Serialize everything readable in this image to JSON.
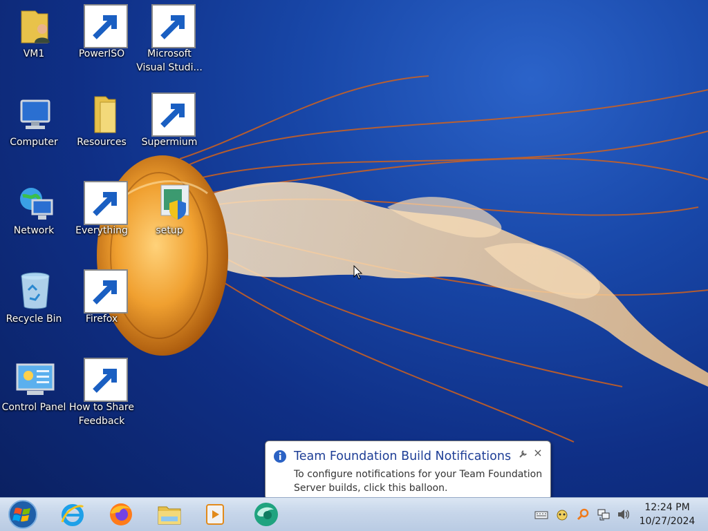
{
  "desktop": {
    "icons": [
      {
        "label": "VM1",
        "icon": "user-folder-icon"
      },
      {
        "label": "PowerISO",
        "icon": "poweriso-icon"
      },
      {
        "label": "Microsoft Visual Studi...",
        "icon": "visual-studio-icon"
      },
      {
        "label": "Computer",
        "icon": "computer-icon"
      },
      {
        "label": "Resources",
        "icon": "folder-icon"
      },
      {
        "label": "Supermium",
        "icon": "supermium-icon"
      },
      {
        "label": "Network",
        "icon": "network-icon"
      },
      {
        "label": "Everything",
        "icon": "everything-search-icon"
      },
      {
        "label": "setup",
        "icon": "setup-icon"
      },
      {
        "label": "Recycle Bin",
        "icon": "recycle-bin-icon"
      },
      {
        "label": "Firefox",
        "icon": "firefox-icon"
      },
      {
        "label": "Control Panel",
        "icon": "control-panel-icon"
      },
      {
        "label": "How to Share Feedback",
        "icon": "help-icon"
      }
    ]
  },
  "taskbar": {
    "apps": [
      "internet-explorer-icon",
      "firefox-icon",
      "file-explorer-icon",
      "media-player-icon",
      "supermium-icon"
    ],
    "tray": [
      "keyboard-icon",
      "tfs-build-icon",
      "search-icon",
      "network-icon",
      "volume-icon"
    ],
    "clock": {
      "time": "12:24 PM",
      "date": "10/27/2024"
    }
  },
  "notification": {
    "title": "Team Foundation Build Notifications",
    "body": "To configure notifications for your Team Foundation Server builds, click this balloon.",
    "close": "×"
  },
  "colors": {
    "accent": "#1e3e96",
    "taskbar": "#c7d6ea",
    "wallpaper": "#1847a8"
  }
}
